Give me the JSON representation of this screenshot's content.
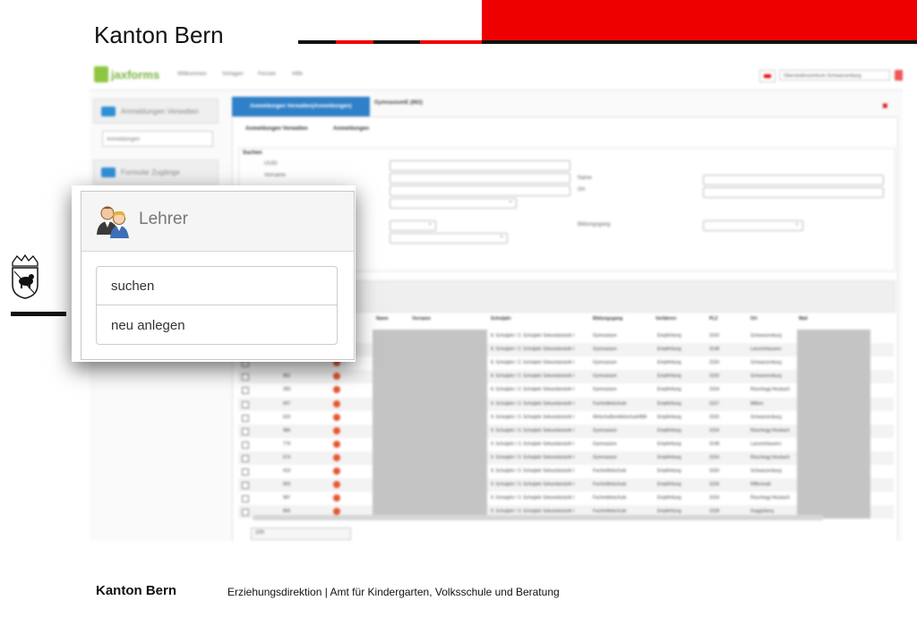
{
  "header": {
    "title": "Kanton Bern",
    "accent_color": "#ee0000"
  },
  "app": {
    "logo_text": "jaxforms",
    "menu": [
      "Willkommen",
      "Vorlagen",
      "Fenster",
      "Hilfe"
    ],
    "org_selector": "Oberstufenzentrum Schwarzenburg",
    "side_cards": [
      "Anmeldungen Verwalten",
      "Formular Zugänge"
    ],
    "side_sub_value": "Anmeldungen",
    "active_tab": "Anmeldungen Verwalten(Anmeldungen)",
    "second_tab": "GymnasiumE (862)",
    "breadcrumb": [
      "Anmeldungen Verwalten",
      "Anmeldungen"
    ],
    "search_heading": "Suchen",
    "search_labels": [
      "UUID",
      "Vorname",
      "Name",
      "Ort",
      "Bildungsgang"
    ],
    "columns": [
      "Name",
      "Vorname",
      "Schuljahr",
      "Bildungsgang",
      "Vorfahren",
      "PLZ",
      "Ort",
      "Mail"
    ],
    "rows": [
      {
        "schuljahr": "8. Schuljahr / 2. Schuljahr Sekundarstufe I",
        "bildungsgang": "Gymnasium",
        "vorfahren": "Empfehlung",
        "plz": "3150",
        "ort": "Schwarzenburg"
      },
      {
        "schuljahr": "8. Schuljahr / 2. Schuljahr Sekundarstufe I",
        "bildungsgang": "Gymnasium",
        "vorfahren": "Empfehlung",
        "plz": "3148",
        "ort": "Lanzenhäusern"
      },
      {
        "schuljahr": "8. Schuljahr / 2. Schuljahr Sekundarstufe I",
        "bildungsgang": "Gymnasium",
        "vorfahren": "Empfehlung",
        "plz": "3150",
        "ort": "Schwarzenburg"
      },
      {
        "id": "882",
        "schuljahr": "8. Schuljahr / 2. Schuljahr Sekundarstufe I",
        "bildungsgang": "Gymnasium",
        "vorfahren": "Empfehlung",
        "plz": "3150",
        "ort": "Schwarzenburg"
      },
      {
        "id": "283",
        "schuljahr": "8. Schuljahr / 2. Schuljahr Sekundarstufe I",
        "bildungsgang": "Gymnasium",
        "vorfahren": "Empfehlung",
        "plz": "3154",
        "ort": "Rüschegg Heubach"
      },
      {
        "id": "697",
        "schuljahr": "9. Schuljahr / 3. Schuljahr Sekundarstufe I",
        "bildungsgang": "Fachmittelschule",
        "vorfahren": "Empfehlung",
        "plz": "3157",
        "ort": "Milken"
      },
      {
        "id": "620",
        "schuljahr": "9. Schuljahr / 3. Schuljahr Sekundarstufe I",
        "bildungsgang": "Wirtschaftsmittelschule/BM",
        "vorfahren": "Empfehlung",
        "plz": "3150",
        "ort": "Schwarzenburg"
      },
      {
        "id": "986",
        "schuljahr": "9. Schuljahr / 3. Schuljahr Sekundarstufe I",
        "bildungsgang": "Gymnasium",
        "vorfahren": "Empfehlung",
        "plz": "3154",
        "ort": "Rüschegg Heubach"
      },
      {
        "id": "779",
        "schuljahr": "9. Schuljahr / 3. Schuljahr Sekundarstufe I",
        "bildungsgang": "Gymnasium",
        "vorfahren": "Empfehlung",
        "plz": "3148",
        "ort": "Lanzenhäusern"
      },
      {
        "id": "574",
        "schuljahr": "9. Schuljahr / 3. Schuljahr Sekundarstufe I",
        "bildungsgang": "Gymnasium",
        "vorfahren": "Empfehlung",
        "plz": "3154",
        "ort": "Rüschegg Heubach"
      },
      {
        "id": "919",
        "schuljahr": "9. Schuljahr / 3. Schuljahr Sekundarstufe I",
        "bildungsgang": "Fachmittelschule",
        "vorfahren": "Empfehlung",
        "plz": "3150",
        "ort": "Schwarzenburg"
      },
      {
        "id": "903",
        "schuljahr": "9. Schuljahr / 3. Schuljahr Sekundarstufe I",
        "bildungsgang": "Fachmittelschule",
        "vorfahren": "Empfehlung",
        "plz": "3156",
        "ort": "Riffenmatt"
      },
      {
        "id": "987",
        "schuljahr": "9. Schuljahr / 3. Schuljahr Sekundarstufe I",
        "bildungsgang": "Fachmittelschule",
        "vorfahren": "Empfehlung",
        "plz": "3154",
        "ort": "Rüschegg Heubach"
      },
      {
        "id": "805",
        "schuljahr": "9. Schuljahr / 3. Schuljahr Sekundarstufe I",
        "bildungsgang": "Fachmittelschule",
        "vorfahren": "Empfehlung",
        "plz": "3158",
        "ort": "Guggisberg"
      }
    ],
    "pager_value": "100"
  },
  "popup": {
    "title": "Lehrer",
    "icon": "teachers-icon",
    "items": [
      "suchen",
      "neu anlegen"
    ]
  },
  "footer": {
    "brand": "Kanton Bern",
    "text": "Erziehungsdirektion | Amt für Kindergarten, Volksschule und Beratung"
  }
}
